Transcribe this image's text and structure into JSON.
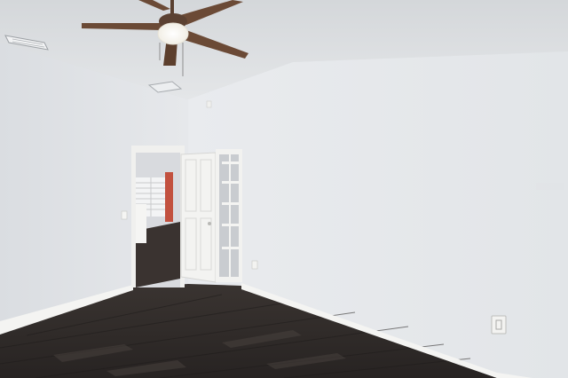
{
  "image": {
    "kind": "photo",
    "subject": "empty-room-interior",
    "elements": [
      "ceiling-fan",
      "open-doorway",
      "closet-door",
      "walk-in-closet-shelving",
      "hardwood-floor",
      "baseboard",
      "wall-outlet",
      "hvac-vents"
    ]
  },
  "colors": {
    "ceiling": "#dfe1e3",
    "left_wall": "#e3e5e8",
    "right_wall": "#eceef0",
    "floor": "#2e2a28",
    "baseboard": "#f6f6f4",
    "fan_blade": "#6b4a36",
    "door": "#f2f2f0"
  }
}
